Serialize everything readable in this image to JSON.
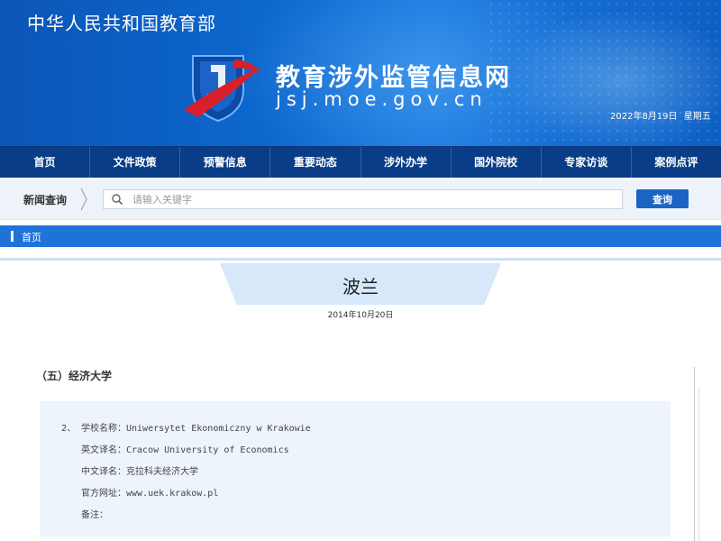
{
  "header": {
    "ministry": "中华人民共和国教育部",
    "site_title": "教育涉外监管信息网",
    "site_url": "jsj.moe.gov.cn",
    "date": "2022年8月19日",
    "weekday": "星期五",
    "colors": {
      "banner": "#0d66cc",
      "nav": "#0a3d87",
      "logo_red": "#d8202a"
    }
  },
  "nav": {
    "items": [
      "首页",
      "文件政策",
      "预警信息",
      "重要动态",
      "涉外办学",
      "国外院校",
      "专家访谈",
      "案例点评"
    ]
  },
  "search": {
    "label": "新闻查询",
    "placeholder": "请输入关键字",
    "button": "查询",
    "icon": "search-icon"
  },
  "breadcrumb": {
    "home": "首页"
  },
  "article": {
    "title": "波兰",
    "date": "2014年10月20日",
    "section": "（五）经济大学",
    "entry": {
      "number": "2、",
      "fields": [
        {
          "label": "学校名称：",
          "value": "Uniwersytet Ekonomiczny w Krakowie"
        },
        {
          "label": "英文译名：",
          "value": "Cracow University of Economics"
        },
        {
          "label": "中文译名：",
          "value": "克拉科夫经济大学"
        },
        {
          "label": "官方网址：",
          "value": "www.uek.krakow.pl"
        },
        {
          "label": "备注：",
          "value": ""
        }
      ]
    }
  }
}
